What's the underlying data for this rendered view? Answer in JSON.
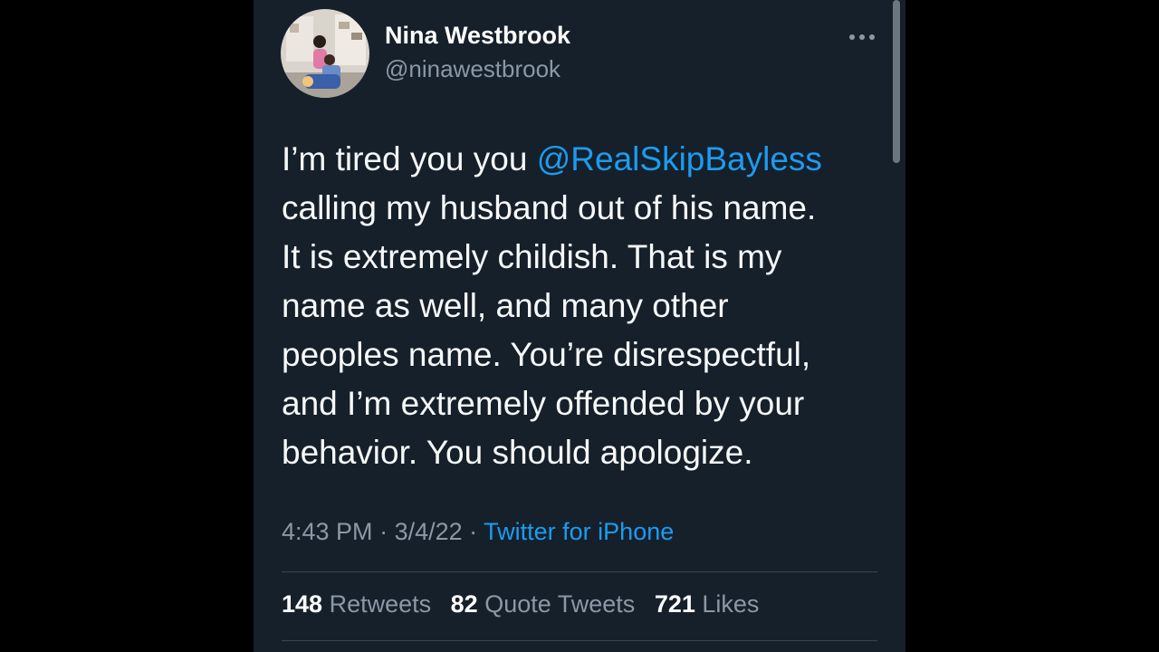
{
  "tweet": {
    "display_name": "Nina Westbrook",
    "handle": "@ninawestbrook",
    "more_icon": "more-horizontal-icon",
    "text_before": "I’m tired you you ",
    "mention": "@RealSkipBayless",
    "text_after": "\ncalling my husband out of his name.\nIt is extremely childish. That is my\nname as well, and many other\npeoples name. You’re disrespectful,\nand I’m extremely offended by your\nbehavior. You should apologize.",
    "time": "4:43 PM",
    "separator": " · ",
    "date": "3/4/22",
    "source": "Twitter for iPhone"
  },
  "stats": {
    "retweets_count": "148",
    "retweets_label": " Retweets",
    "quotes_count": "82",
    "quotes_label": " Quote Tweets",
    "likes_count": "721",
    "likes_label": " Likes"
  },
  "colors": {
    "background": "#15202b",
    "link": "#1d9bf0",
    "secondary_text": "#8b98a5",
    "divider": "#38444d"
  }
}
